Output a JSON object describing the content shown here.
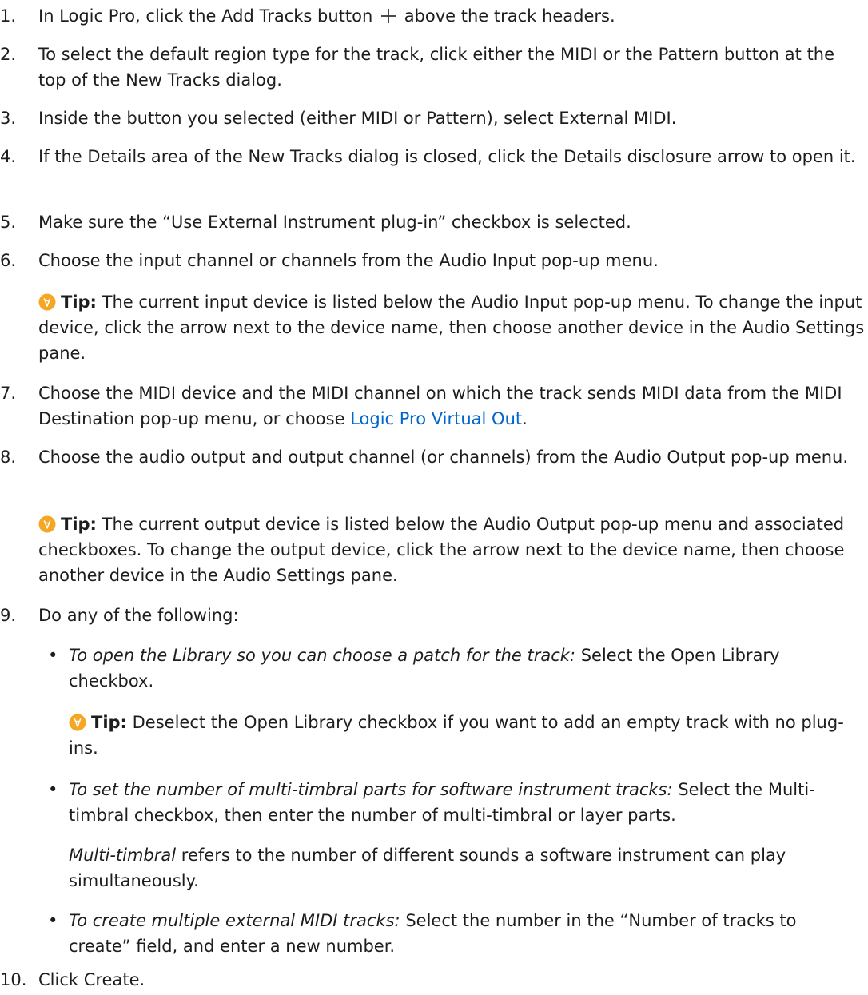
{
  "steps": [
    {
      "num": "1.",
      "a": "In Logic Pro, click the Add Tracks button",
      "b": "above the track headers."
    },
    {
      "num": "2.",
      "text": "To select the default region type for the track, click either the MIDI or the Pattern button at the top of the New Tracks dialog."
    },
    {
      "num": "3.",
      "text": "Inside the button you selected (either MIDI or Pattern), select External MIDI."
    },
    {
      "num": "4.",
      "text": "If the Details area of the New Tracks dialog is closed, click the Details disclosure arrow to open it."
    },
    {
      "num": "5.",
      "text": "Make sure the “Use External Instrument plug-in” checkbox is selected."
    },
    {
      "num": "6.",
      "text": "Choose the input channel or channels from the Audio Input pop-up menu."
    },
    {
      "num": "7.",
      "a": "Choose the MIDI device and the MIDI channel on which the track sends MIDI data from the MIDI Destination pop-up menu, or choose",
      "link": "Logic Pro Virtual Out",
      "b": "."
    },
    {
      "num": "8.",
      "text": "Choose the audio output and output channel (or channels) from the Audio Output pop-up menu."
    },
    {
      "num": "9.",
      "text": "Do any of the following:"
    },
    {
      "num": "10.",
      "text": "Click Create."
    }
  ],
  "tips": [
    {
      "label": "Tip:",
      "text": "The current input device is listed below the Audio Input pop-up menu. To change the input device, click the arrow next to the device name, then choose another device in the Audio Settings pane."
    },
    {
      "label": "Tip:",
      "text": "The current output device is listed below the Audio Output pop-up menu and associated checkboxes. To change the output device, click the arrow next to the device name, then choose another device in the Audio Settings pane."
    },
    {
      "label": "Tip:",
      "text": "Deselect the Open Library checkbox if you want to add an empty track with no plug-ins."
    }
  ],
  "bullets": [
    {
      "em": "To open the Library so you can choose a patch for the track:",
      "text": "Select the Open Library checkbox."
    },
    {
      "em": "To set the number of multi-timbral parts for software instrument tracks:",
      "text": "Select the Multi-timbral checkbox, then enter the number of multi-timbral or layer parts."
    },
    {
      "em": "To create multiple external MIDI tracks:",
      "text": "Select the number in the “Number of tracks to create” field, and enter a new number."
    }
  ],
  "multi_timbral_note": {
    "em": "Multi-timbral",
    "text": "refers to the number of different sounds a software instrument can play simultaneously."
  },
  "bullet_char": "•",
  "icons": {
    "tip": "lightbulb-icon",
    "add": "plus-icon"
  },
  "colors": {
    "text": "#1d1d1f",
    "link": "#0066cc",
    "tip": "#f5a623"
  }
}
